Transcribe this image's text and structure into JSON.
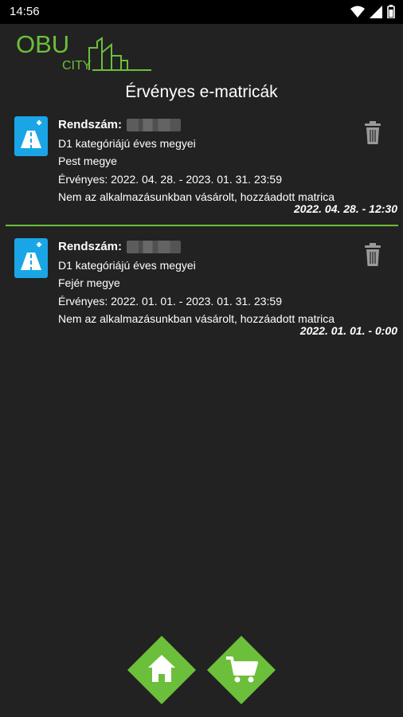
{
  "status_bar": {
    "time": "14:56",
    "icons": [
      "wifi-icon",
      "signal-icon",
      "battery-icon"
    ]
  },
  "logo": {
    "line1": "OBU",
    "line2": "CITY"
  },
  "page_title": "Érvényes e-matricák",
  "colors": {
    "accent_green": "#6cbf3a",
    "icon_blue": "#1aa6e6",
    "background": "#222222"
  },
  "vignettes": [
    {
      "plate_label": "Rendszám:",
      "category": "D1 kategóriájú éves megyei",
      "county": "Pest megye",
      "validity": "Érvényes: 2022. 04. 28. - 2023. 01. 31. 23:59",
      "source": "Nem az alkalmazásunkban vásárolt, hozzáadott matrica",
      "date": "2022. 04. 28. - 12:30"
    },
    {
      "plate_label": "Rendszám:",
      "category": "D1 kategóriájú éves megyei",
      "county": "Fejér megye",
      "validity": "Érvényes: 2022. 01. 01. - 2023. 01. 31. 23:59",
      "source": "Nem az alkalmazásunkban vásárolt, hozzáadott matrica",
      "date": "2022. 01. 01. - 0:00"
    }
  ],
  "nav": {
    "home_icon": "home-icon",
    "cart_icon": "cart-icon"
  }
}
